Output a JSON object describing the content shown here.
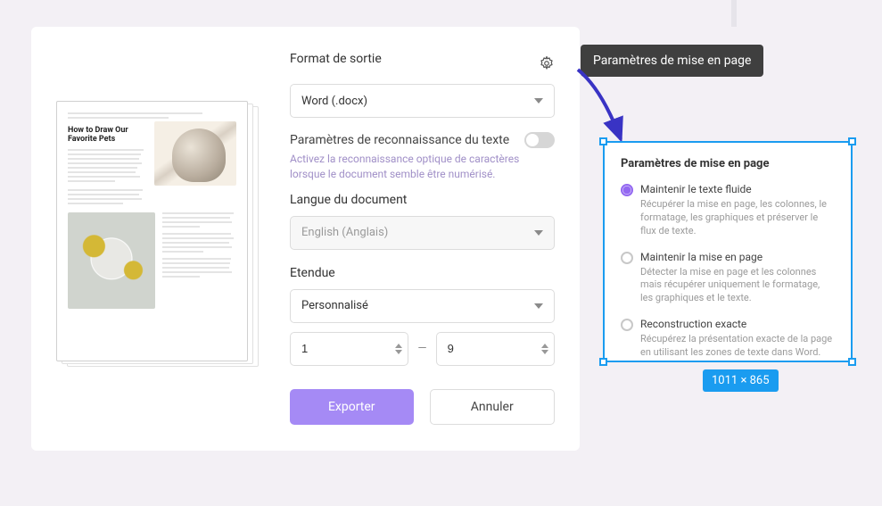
{
  "export": {
    "format_section": "Format de sortie",
    "format_selected": "Word (.docx)",
    "ocr_label": "Paramètres de reconnaissance du texte",
    "ocr_enabled": false,
    "ocr_desc": "Activez la reconnaissance optique de caractères lorsque le document semble être numérisé.",
    "language_section": "Langue du document",
    "language_selected": "English (Anglais)",
    "range_section": "Etendue",
    "range_selected": "Personnalisé",
    "range_from": "1",
    "range_to": "9",
    "btn_export": "Exporter",
    "btn_cancel": "Annuler"
  },
  "preview": {
    "heading": "How to Draw Our Favorite Pets"
  },
  "tooltip": "Paramètres de mise en page",
  "layout_panel": {
    "title": "Paramètres de mise en page",
    "options": [
      {
        "label": "Maintenir le texte fluide",
        "desc": "Récupérer la mise en page, les colonnes, le formatage, les graphiques et préserver le flux de texte.",
        "selected": true
      },
      {
        "label": "Maintenir la mise en page",
        "desc": "Détecter la mise en page et les colonnes mais récupérer uniquement le formatage, les graphiques et le texte.",
        "selected": false
      },
      {
        "label": "Reconstruction exacte",
        "desc": "Récupérez la présentation exacte de la page en utilisant les zones de texte dans Word.",
        "selected": false
      }
    ]
  },
  "dims_badge": "1011 × 865"
}
